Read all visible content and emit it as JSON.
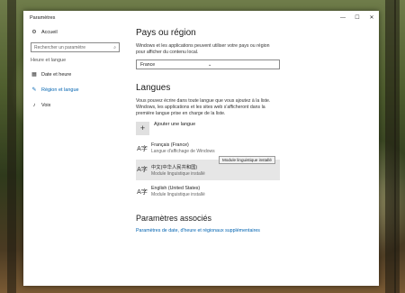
{
  "window": {
    "title": "Paramètres",
    "controls": {
      "minimize": "—",
      "maximize": "☐",
      "close": "✕"
    }
  },
  "sidebar": {
    "home": {
      "icon": "gear-icon",
      "label": "Accueil"
    },
    "search": {
      "placeholder": "Rechercher un paramètre",
      "icon": "search-icon"
    },
    "group_label": "Heure et langue",
    "items": [
      {
        "icon": "calendar-clock-icon",
        "label": "Date et heure",
        "active": false
      },
      {
        "icon": "region-language-icon",
        "label": "Région et langue",
        "active": true
      },
      {
        "icon": "microphone-icon",
        "label": "Voix",
        "active": false
      }
    ]
  },
  "main": {
    "region": {
      "heading": "Pays ou région",
      "description": "Windows et les applications peuvent utiliser votre pays ou région pour afficher du contenu local.",
      "selected_country": "France"
    },
    "languages": {
      "heading": "Langues",
      "description": "Vous pouvez écrire dans toute langue que vous ajoutez à la liste. Windows, les applications et les sites web s'afficheront dans la première langue prise en charge de la liste.",
      "add_label": "Ajouter une langue",
      "items": [
        {
          "name": "Français (France)",
          "sub": "Langue d'affichage de Windows"
        },
        {
          "name": "中文(中华人民共和国)",
          "sub": "Module linguistique installé",
          "tooltip": "Module linguistique installé"
        },
        {
          "name": "English (United States)",
          "sub": "Module linguistique installé"
        }
      ]
    },
    "related": {
      "heading": "Paramètres associés",
      "link": "Paramètres de date, d'heure et régionaux supplémentaires"
    }
  }
}
